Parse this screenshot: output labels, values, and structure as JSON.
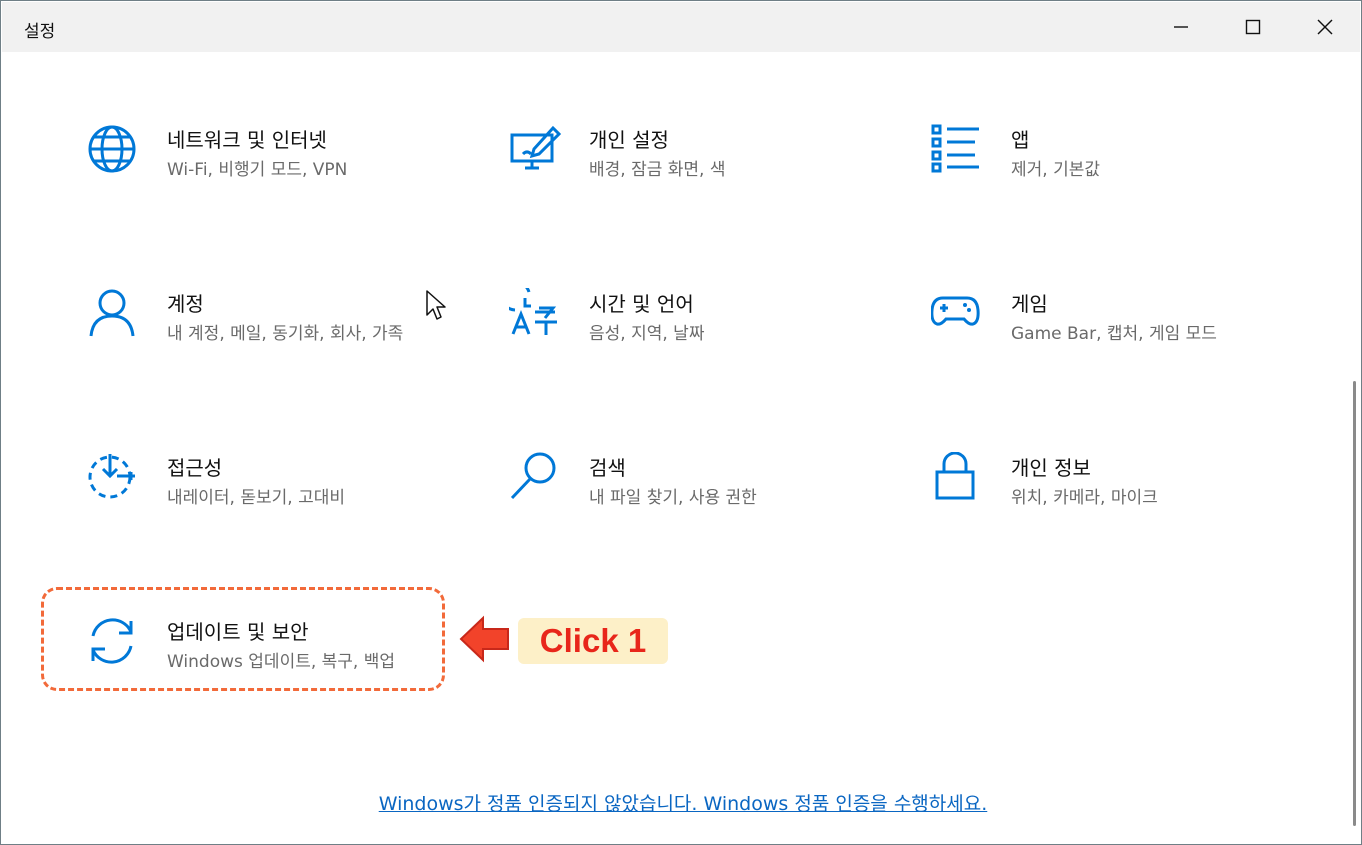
{
  "window": {
    "title": "설정"
  },
  "tiles": [
    {
      "label": "네트워크 및 인터넷",
      "desc": "Wi-Fi, 비행기 모드, VPN",
      "icon": "globe-icon"
    },
    {
      "label": "개인 설정",
      "desc": "배경, 잠금 화면, 색",
      "icon": "personalization-icon"
    },
    {
      "label": "앱",
      "desc": "제거, 기본값",
      "icon": "apps-list-icon"
    },
    {
      "label": "계정",
      "desc": "내 계정, 메일, 동기화, 회사, 가족",
      "icon": "person-icon"
    },
    {
      "label": "시간 및 언어",
      "desc": "음성, 지역, 날짜",
      "icon": "time-language-icon"
    },
    {
      "label": "게임",
      "desc": "Game Bar, 캡처, 게임 모드",
      "icon": "gamepad-icon"
    },
    {
      "label": "접근성",
      "desc": "내레이터, 돋보기, 고대비",
      "icon": "accessibility-icon"
    },
    {
      "label": "검색",
      "desc": "내 파일 찾기, 사용 권한",
      "icon": "search-icon"
    },
    {
      "label": "개인 정보",
      "desc": "위치, 카메라, 마이크",
      "icon": "lock-icon"
    },
    {
      "label": "업데이트 및 보안",
      "desc": "Windows 업데이트, 복구, 백업",
      "icon": "sync-icon"
    }
  ],
  "annotation": {
    "click_label": "Click 1"
  },
  "footer": {
    "activation_link": "Windows가 정품 인증되지 않았습니다. Windows 정품 인증을 수행하세요."
  },
  "colors": {
    "accent": "#0078d7",
    "highlight": "#f26a3a",
    "badge_bg": "#fdf0c8",
    "badge_text": "#e8261a",
    "link": "#0a66c2"
  }
}
